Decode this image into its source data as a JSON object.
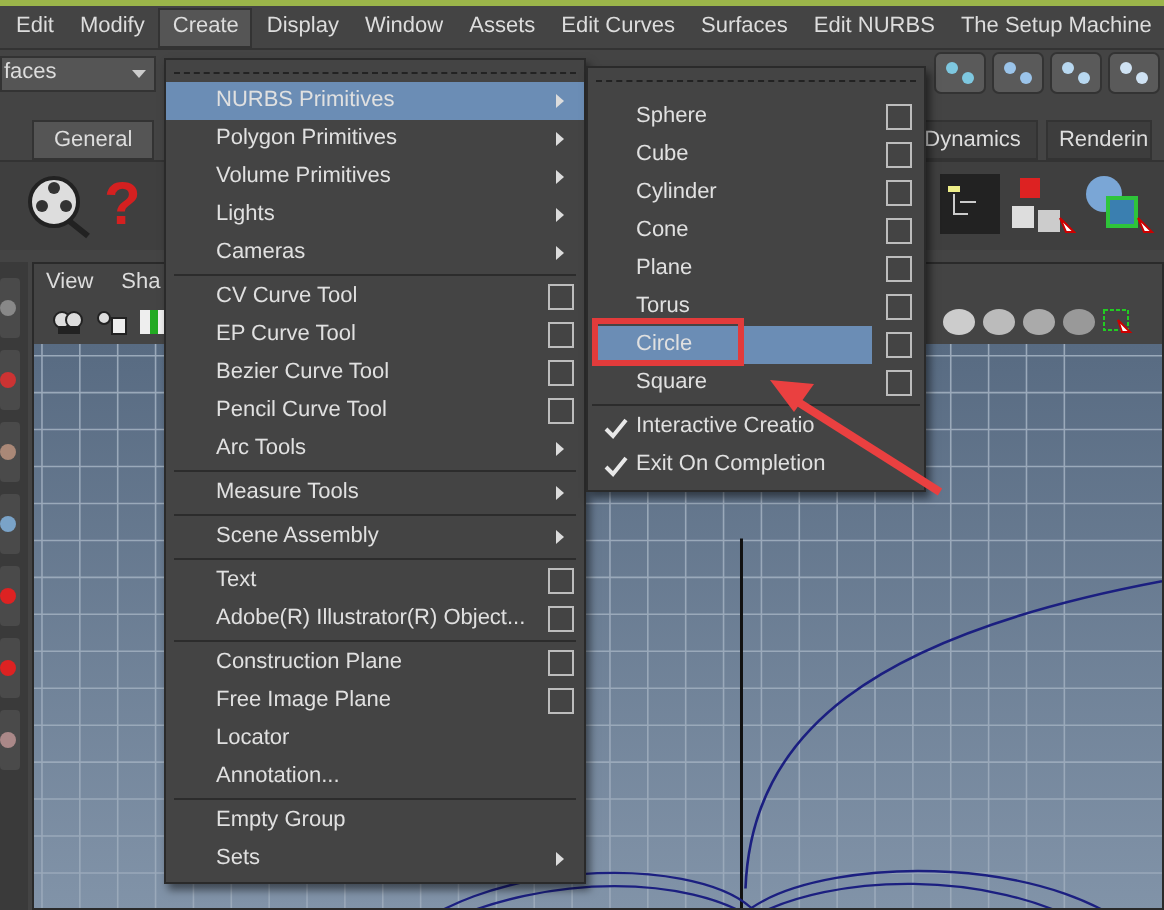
{
  "menu_bar": [
    {
      "label": "Edit",
      "selected": false
    },
    {
      "label": "Modify",
      "selected": false
    },
    {
      "label": "Create",
      "selected": true
    },
    {
      "label": "Display",
      "selected": false
    },
    {
      "label": "Window",
      "selected": false
    },
    {
      "label": "Assets",
      "selected": false
    },
    {
      "label": "Edit Curves",
      "selected": false
    },
    {
      "label": "Surfaces",
      "selected": false
    },
    {
      "label": "Edit NURBS",
      "selected": false
    },
    {
      "label": "The Setup Machine",
      "selected": false
    }
  ],
  "toolbar": {
    "menu_set": "faces"
  },
  "shelf_tabs": [
    {
      "label": "General",
      "selected": true
    },
    {
      "label": "Dynamics",
      "selected": false
    },
    {
      "label": "Renderin",
      "selected": false
    }
  ],
  "shelf": {
    "help_glyph": "?"
  },
  "viewport": {
    "menus": [
      "View",
      "Sha"
    ]
  },
  "create_menu": [
    {
      "kind": "item",
      "label": "NURBS Primitives",
      "submenu": true,
      "options": false,
      "selected": true
    },
    {
      "kind": "item",
      "label": "Polygon Primitives",
      "submenu": true,
      "options": false,
      "selected": false
    },
    {
      "kind": "item",
      "label": "Volume Primitives",
      "submenu": true,
      "options": false,
      "selected": false
    },
    {
      "kind": "item",
      "label": "Lights",
      "submenu": true,
      "options": false,
      "selected": false
    },
    {
      "kind": "item",
      "label": "Cameras",
      "submenu": true,
      "options": false,
      "selected": false
    },
    {
      "kind": "separator"
    },
    {
      "kind": "item",
      "label": "CV Curve Tool",
      "submenu": false,
      "options": true,
      "selected": false
    },
    {
      "kind": "item",
      "label": "EP Curve Tool",
      "submenu": false,
      "options": true,
      "selected": false
    },
    {
      "kind": "item",
      "label": "Bezier Curve Tool",
      "submenu": false,
      "options": true,
      "selected": false
    },
    {
      "kind": "item",
      "label": "Pencil Curve Tool",
      "submenu": false,
      "options": true,
      "selected": false
    },
    {
      "kind": "item",
      "label": "Arc Tools",
      "submenu": true,
      "options": false,
      "selected": false
    },
    {
      "kind": "separator"
    },
    {
      "kind": "item",
      "label": "Measure Tools",
      "submenu": true,
      "options": false,
      "selected": false
    },
    {
      "kind": "separator"
    },
    {
      "kind": "item",
      "label": "Scene Assembly",
      "submenu": true,
      "options": false,
      "selected": false
    },
    {
      "kind": "separator"
    },
    {
      "kind": "item",
      "label": "Text",
      "submenu": false,
      "options": true,
      "selected": false
    },
    {
      "kind": "item",
      "label": "Adobe(R) Illustrator(R) Object...",
      "submenu": false,
      "options": true,
      "selected": false
    },
    {
      "kind": "separator"
    },
    {
      "kind": "item",
      "label": "Construction Plane",
      "submenu": false,
      "options": true,
      "selected": false
    },
    {
      "kind": "item",
      "label": "Free Image Plane",
      "submenu": false,
      "options": true,
      "selected": false
    },
    {
      "kind": "item",
      "label": "Locator",
      "submenu": false,
      "options": false,
      "selected": false
    },
    {
      "kind": "item",
      "label": "Annotation...",
      "submenu": false,
      "options": false,
      "selected": false
    },
    {
      "kind": "separator"
    },
    {
      "kind": "item",
      "label": "Empty Group",
      "submenu": false,
      "options": false,
      "selected": false
    },
    {
      "kind": "item",
      "label": "Sets",
      "submenu": true,
      "options": false,
      "selected": false
    }
  ],
  "nurbs_submenu": [
    {
      "kind": "item",
      "label": "Sphere",
      "options": true,
      "selected": false
    },
    {
      "kind": "item",
      "label": "Cube",
      "options": true,
      "selected": false
    },
    {
      "kind": "item",
      "label": "Cylinder",
      "options": true,
      "selected": false
    },
    {
      "kind": "item",
      "label": "Cone",
      "options": true,
      "selected": false
    },
    {
      "kind": "item",
      "label": "Plane",
      "options": true,
      "selected": false
    },
    {
      "kind": "item",
      "label": "Torus",
      "options": true,
      "selected": false
    },
    {
      "kind": "item",
      "label": "Circle",
      "options": true,
      "selected": true
    },
    {
      "kind": "item",
      "label": "Square",
      "options": true,
      "selected": false
    },
    {
      "kind": "separator"
    },
    {
      "kind": "check",
      "label": "Interactive Creatio",
      "checked": true
    },
    {
      "kind": "check",
      "label": "Exit On Completion",
      "checked": true
    }
  ]
}
